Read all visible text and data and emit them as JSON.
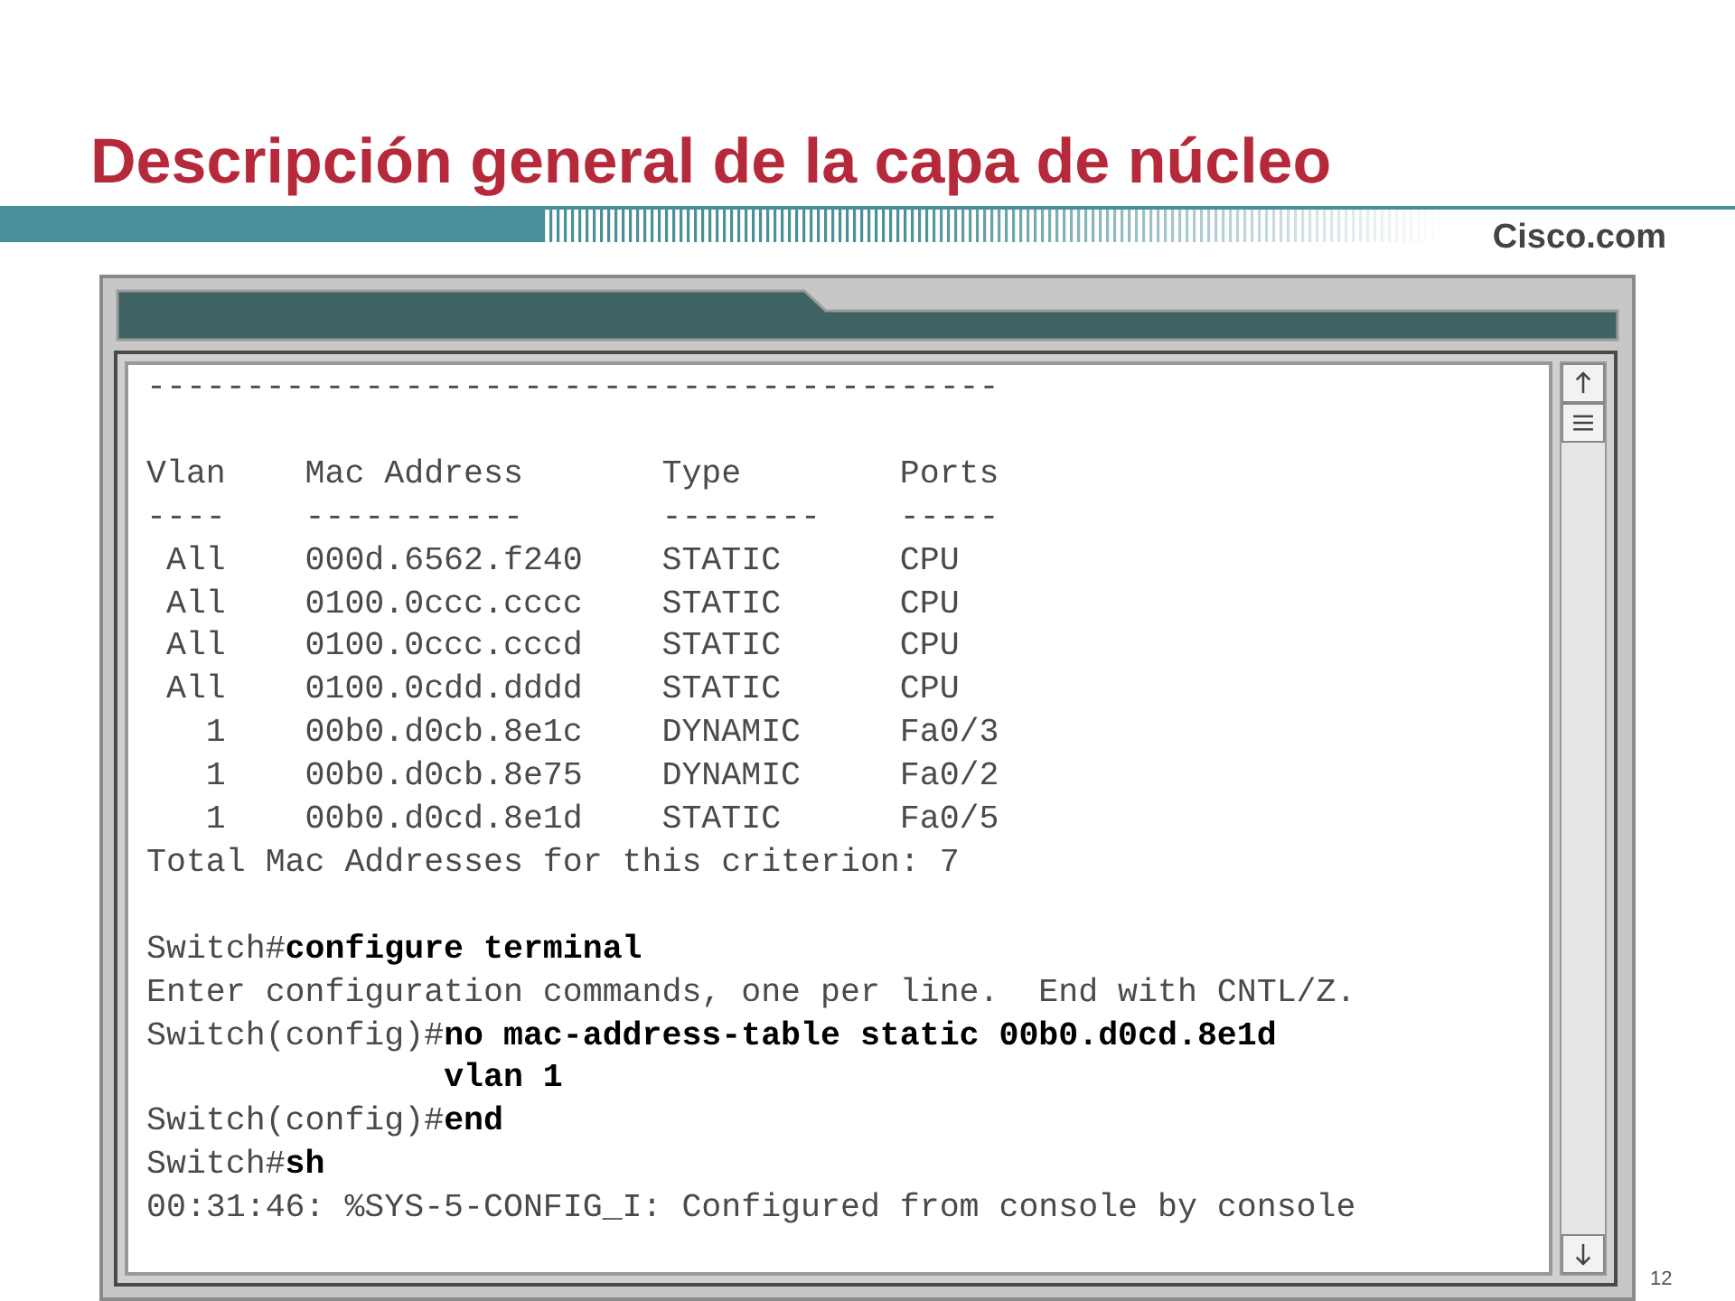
{
  "slide": {
    "title": "Descripción general de la capa de núcleo",
    "brand": "Cisco.com",
    "page_number": "12"
  },
  "terminal": {
    "blocks": [
      {
        "lines": [
          "-------------------------------------------"
        ]
      },
      {
        "lines": [
          "Vlan    Mac Address       Type        Ports",
          "----    -----------       --------    -----",
          " All    000d.6562.f240    STATIC      CPU",
          " All    0100.0ccc.cccc    STATIC      CPU",
          " All    0100.0ccc.cccd    STATIC      CPU",
          " All    0100.0cdd.dddd    STATIC      CPU",
          "   1    00b0.d0cb.8e1c    DYNAMIC     Fa0/3",
          "   1    00b0.d0cb.8e75    DYNAMIC     Fa0/2",
          "   1    00b0.d0cd.8e1d    STATIC      Fa0/5",
          "Total Mac Addresses for this criterion: 7"
        ]
      },
      {
        "lines": [
          "Switch#**configure terminal**",
          "Enter configuration commands, one per line.  End with CNTL/Z.",
          "Switch(config)#**no mac-address-table static 00b0.d0cd.8e1d**",
          "               **vlan 1**",
          "Switch(config)#**end**",
          "Switch#**sh**",
          "00:31:46: %SYS-5-CONFIG_I: Configured from console by console"
        ]
      }
    ]
  }
}
